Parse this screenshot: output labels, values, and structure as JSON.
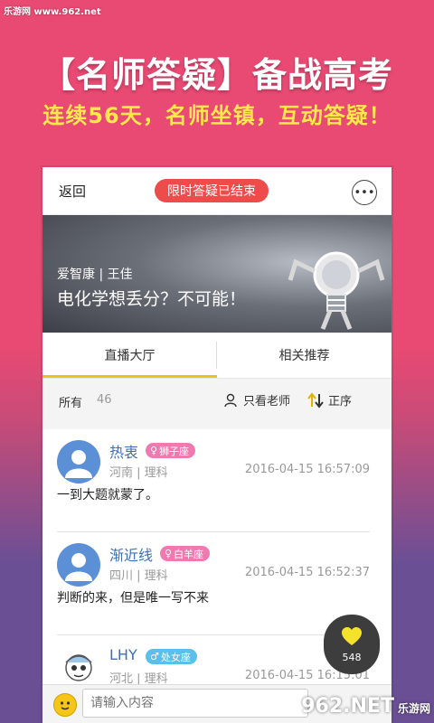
{
  "watermark_top": "乐游网 www.962.net",
  "promo": {
    "headline": "【名师答疑】备战高考",
    "subline": "连续56天，名师坐镇，互动答疑！"
  },
  "topbar": {
    "back_label": "返回",
    "status_label": "限时答疑已结束",
    "more_icon": "more-icon"
  },
  "banner": {
    "author": "爱智康 | 王佳",
    "title": "电化学想丢分？不可能！"
  },
  "tabs": [
    {
      "label": "直播大厅",
      "active": true
    },
    {
      "label": "相关推荐",
      "active": false
    }
  ],
  "filter": {
    "all_label": "所有",
    "count": "46",
    "teacher_only_label": "只看老师",
    "order_label": "正序"
  },
  "comments": [
    {
      "username": "热衷",
      "zodiac": "狮子座",
      "zodiac_color": "#f07ab0",
      "gender": "female",
      "region": "河南",
      "subject": "理科",
      "time": "2016-04-15 16:57:09",
      "text": "一到大题就蒙了。"
    },
    {
      "username": "渐近线",
      "zodiac": "白羊座",
      "zodiac_color": "#f07ab0",
      "gender": "female",
      "region": "四川",
      "subject": "理科",
      "time": "2016-04-15 16:52:37",
      "text": "判断的来，但是唯一写不来"
    },
    {
      "username": "LHY",
      "zodiac": "处女座",
      "zodiac_color": "#58c0ea",
      "gender": "male",
      "region": "河北",
      "subject": "理科",
      "time": "2016-04-15 16:15:01",
      "text": ""
    }
  ],
  "like": {
    "count": "548"
  },
  "input": {
    "placeholder": "请输入内容"
  },
  "watermark_bottom": {
    "logo": "962",
    "suffix": ".NET",
    "site": "乐游网"
  },
  "colors": {
    "accent_red": "#ee4b4b",
    "tab_underline": "#f0c020",
    "username_blue": "#3f6fb5"
  }
}
